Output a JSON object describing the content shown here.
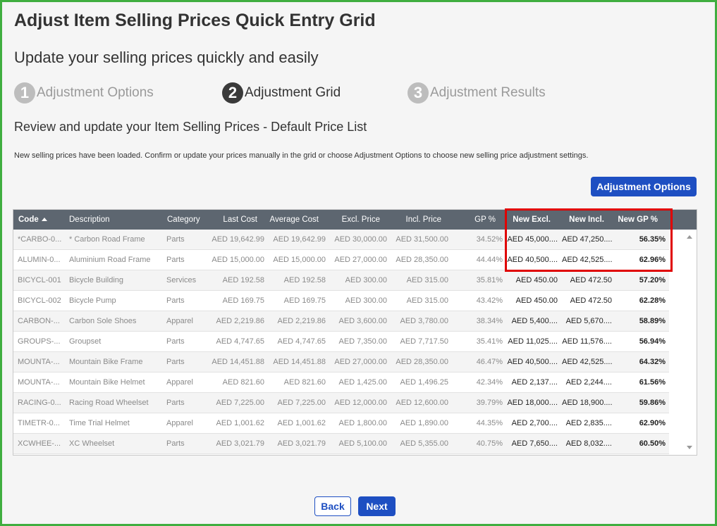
{
  "page": {
    "title": "Adjust Item Selling Prices Quick Entry Grid",
    "subtitle": "Update your selling prices quickly and easily",
    "section_title": "Review and update your Item Selling Prices - Default Price List",
    "info_text": "New selling prices have been loaded. Confirm or update your prices manually in the grid or choose Adjustment Options to choose new selling price adjustment settings."
  },
  "steps": [
    {
      "num": "1",
      "label": "Adjustment Options",
      "state": "inactive"
    },
    {
      "num": "2",
      "label": "Adjustment Grid",
      "state": "active"
    },
    {
      "num": "3",
      "label": "Adjustment Results",
      "state": "inactive"
    }
  ],
  "buttons": {
    "adjustment_options": "Adjustment Options",
    "back": "Back",
    "next": "Next"
  },
  "grid": {
    "columns": [
      "Code",
      "Description",
      "Category",
      "Last Cost",
      "Average Cost",
      "Excl. Price",
      "Incl. Price",
      "GP %",
      "New Excl.",
      "New Incl.",
      "New GP %"
    ],
    "rows": [
      [
        "*CARBO-0...",
        "* Carbon Road Frame",
        "Parts",
        "AED 19,642.99",
        "AED 19,642.99",
        "AED 30,000.00",
        "AED 31,500.00",
        "34.52%",
        "AED 45,000....",
        "AED 47,250....",
        "56.35%"
      ],
      [
        "ALUMIN-0...",
        "Aluminium Road Frame",
        "Parts",
        "AED 15,000.00",
        "AED 15,000.00",
        "AED 27,000.00",
        "AED 28,350.00",
        "44.44%",
        "AED 40,500....",
        "AED 42,525....",
        "62.96%"
      ],
      [
        "BICYCL-001",
        "Bicycle Building",
        "Services",
        "AED 192.58",
        "AED 192.58",
        "AED 300.00",
        "AED 315.00",
        "35.81%",
        "AED 450.00",
        "AED 472.50",
        "57.20%"
      ],
      [
        "BICYCL-002",
        "Bicycle Pump",
        "Parts",
        "AED 169.75",
        "AED 169.75",
        "AED 300.00",
        "AED 315.00",
        "43.42%",
        "AED 450.00",
        "AED 472.50",
        "62.28%"
      ],
      [
        "CARBON-...",
        "Carbon Sole Shoes",
        "Apparel",
        "AED 2,219.86",
        "AED 2,219.86",
        "AED 3,600.00",
        "AED 3,780.00",
        "38.34%",
        "AED 5,400....",
        "AED 5,670....",
        "58.89%"
      ],
      [
        "GROUPS-...",
        "Groupset",
        "Parts",
        "AED 4,747.65",
        "AED 4,747.65",
        "AED 7,350.00",
        "AED 7,717.50",
        "35.41%",
        "AED 11,025....",
        "AED 11,576....",
        "56.94%"
      ],
      [
        "MOUNTA-...",
        "Mountain Bike Frame",
        "Parts",
        "AED 14,451.88",
        "AED 14,451.88",
        "AED 27,000.00",
        "AED 28,350.00",
        "46.47%",
        "AED 40,500....",
        "AED 42,525....",
        "64.32%"
      ],
      [
        "MOUNTA-...",
        "Mountain Bike Helmet",
        "Apparel",
        "AED 821.60",
        "AED 821.60",
        "AED 1,425.00",
        "AED 1,496.25",
        "42.34%",
        "AED 2,137....",
        "AED 2,244....",
        "61.56%"
      ],
      [
        "RACING-0...",
        "Racing Road Wheelset",
        "Parts",
        "AED 7,225.00",
        "AED 7,225.00",
        "AED 12,000.00",
        "AED 12,600.00",
        "39.79%",
        "AED 18,000....",
        "AED 18,900....",
        "59.86%"
      ],
      [
        "TIMETR-0...",
        "Time Trial Helmet",
        "Apparel",
        "AED 1,001.62",
        "AED 1,001.62",
        "AED 1,800.00",
        "AED 1,890.00",
        "44.35%",
        "AED 2,700....",
        "AED 2,835....",
        "62.90%"
      ],
      [
        "XCWHEE-...",
        "XC Wheelset",
        "Parts",
        "AED 3,021.79",
        "AED 3,021.79",
        "AED 5,100.00",
        "AED 5,355.00",
        "40.75%",
        "AED 7,650....",
        "AED 8,032....",
        "60.50%"
      ]
    ]
  },
  "colors": {
    "primary": "#1e4fc2",
    "header_bg": "#5d6670",
    "highlight": "#e00000",
    "frame_border": "#3fae3f"
  }
}
